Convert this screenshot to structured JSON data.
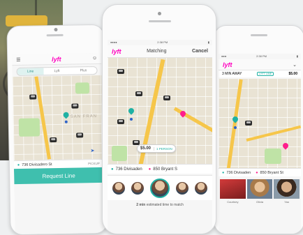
{
  "colors": {
    "brand_pink": "#ff00bf",
    "teal": "#1fb1a4",
    "map_bg": "#e9e3d4",
    "highway": "#f6c64a",
    "park": "#bfe3a6"
  },
  "left_phone": {
    "logo": "lyft",
    "tabs": [
      {
        "label": "Line",
        "active": true
      },
      {
        "label": "Lyft",
        "active": false
      },
      {
        "label": "Plus",
        "active": false
      }
    ],
    "map_label": "SAN FRAN",
    "pickup_address": "736 Divisadero St",
    "pickup_action": "PICKUP",
    "request_button": "Request Line",
    "icons": [
      "menu-icon",
      "profile-icon",
      "location-arrow-icon"
    ]
  },
  "center_phone": {
    "status_time": "2:38 PM",
    "logo": "lyft",
    "title": "Matching",
    "cancel_label": "Cancel",
    "price": "$5.00",
    "price_people": "1 PERSON",
    "pickup_address": "736 Divisaden",
    "dropoff_address": "850 Bryant S",
    "eta_text_bold": "2 min",
    "eta_text": "estimated time to match"
  },
  "right_phone": {
    "status_time": "2:38 PM",
    "logo": "lyft",
    "away_text": "3 MIN AWAY",
    "badge": "LYFT LINE",
    "price": "$5.00",
    "pickup_address": "736 Divisaden",
    "dropoff_address": "850 Bryant St",
    "drivers": [
      {
        "name": "Courtney"
      },
      {
        "name": "Olivia"
      },
      {
        "name": "Yao"
      }
    ]
  }
}
